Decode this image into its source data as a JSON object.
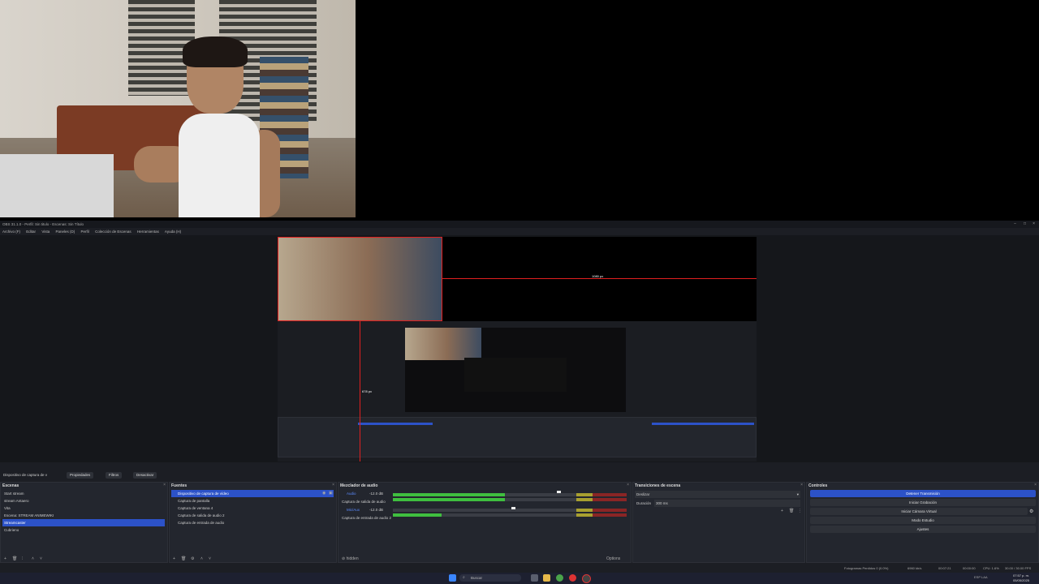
{
  "window": {
    "title": "OBS 31.1.0 - Perfil: Sin titulo - Escenas: Sin Título",
    "controls": [
      "−",
      "□",
      "×"
    ]
  },
  "menu": [
    "Archivo (F)",
    "Editar",
    "Vista",
    "Paneles (D)",
    "Perfil",
    "Colección de Escenas",
    "Herramientas",
    "Ayuda (H)"
  ],
  "preview": {
    "width_label": "1080 px",
    "height_label": "678 px"
  },
  "source_toolbar": {
    "selected_source": "Dispositivo de captura de v",
    "properties": "Propiedades",
    "filters": "Filtros",
    "deactivate": "Desactivar"
  },
  "scenes": {
    "header": "Escenas",
    "items": [
      "Start stream",
      "stream Antaero",
      "Vita",
      "Escena: STREAM ANIMEWIKI",
      "Streamcaster",
      "Cubrieno"
    ],
    "selected_index": 4
  },
  "sources": {
    "header": "Fuentes",
    "items": [
      "Dispositivo de captura de vídeo",
      "Captura de pantalla",
      "Captura de ventana 4",
      "Captura de salida de audio 2",
      "Captura de entrada de audio"
    ],
    "selected_index": 0
  },
  "mixer": {
    "header": "Mezclador de audio",
    "channels": [
      {
        "name": "Audio",
        "level": "-12.0 dB",
        "fill": 0.48
      },
      {
        "name": "Captura de salida de audio",
        "level": "0.0 dB",
        "fill": 0.0
      },
      {
        "name": "Mic/Aux",
        "level": "-12.0 dB",
        "fill": 0.3
      },
      {
        "name": "Captura de entrada de audio 2",
        "level": "0.0 dB",
        "fill": 0.0
      }
    ]
  },
  "transitions": {
    "header": "Transiciones de escena",
    "type": "Deslizar",
    "duration_label": "Duración",
    "duration": "300 ms"
  },
  "controls": {
    "header": "Controles",
    "buttons": [
      "Detener Transmisión",
      "Iniciar Grabación",
      "Iniciar Cámara Virtual",
      "Modo Estudio",
      "Ajustes"
    ]
  },
  "status": {
    "dropped": "Fotogramas Perdidos 0 (0.0%)",
    "bitrate": "6960 kb/s",
    "live": "00:07:21",
    "rec": "00:00:00",
    "cpu": "CPU: 1.6%",
    "fps": "30.00 / 30.00 FPS"
  },
  "taskbar": {
    "search": "Buscar",
    "lang": "ESP LAA",
    "time": "07:57 p. m.",
    "date": "05/05/2025"
  },
  "colors": {
    "accent": "#2c52c8",
    "red_guide": "#e02020",
    "panel": "#23262e",
    "meter_green": "#3fbf3f",
    "meter_red": "#8a2525"
  }
}
